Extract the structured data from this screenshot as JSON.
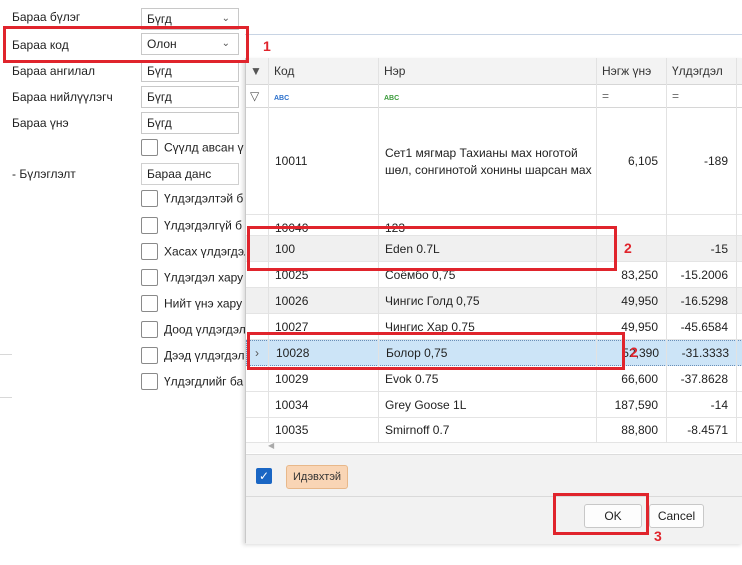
{
  "filters": {
    "category_label": "Бараа бүлэг",
    "category_value": "Бүгд",
    "code_label": "Бараа код",
    "code_value": "Олон",
    "class_label": "Бараа ангилал",
    "class_value": "Бүгд",
    "supplier_label": "Бараа нийлүүлэгч",
    "supplier_value": "Бүгд",
    "price_label": "Бараа үнэ",
    "price_value": "Бүгд",
    "last_taken_label": "Сүүлд авсан ү",
    "grouping_label": "- Бүлэглэлт",
    "grouping_value": "Бараа данс",
    "checkboxes": [
      "Үлдэгдэлтэй б",
      "Үлдэгдэлгүй б",
      "Хасах үлдэгдэл",
      "Үлдэгдэл хару",
      "Нийт үнэ хару",
      "Доод үлдэгдэл",
      "Дээд үлдэгдэл",
      "Үлдэгдлийг ба"
    ]
  },
  "grid": {
    "columns": [
      "Код",
      "Нэр",
      "Нэгж үнэ",
      "Үлдэгдэл"
    ],
    "rows": [
      {
        "code": "10011",
        "name1": "Сет1 мягмар Тахианы мах ноготой",
        "name2": "шөл, сонгинотой хонины шарсан мах",
        "price": "6,105",
        "stock": "-189"
      },
      {
        "code": "10040",
        "name": "123",
        "price": "",
        "stock": ""
      },
      {
        "code": "100",
        "name": "Eden 0.7L",
        "price": "",
        "stock": "-15"
      },
      {
        "code": "10025",
        "name": "Соёмбо 0,75",
        "price": "83,250",
        "stock": "-15.2006"
      },
      {
        "code": "10026",
        "name": "Чингис Голд 0,75",
        "price": "49,950",
        "stock": "-16.5298"
      },
      {
        "code": "10027",
        "name": "Чингис Хар 0.75",
        "price": "49,950",
        "stock": "-45.6584"
      },
      {
        "code": "10028",
        "name": "Болор 0,75",
        "price": "52,390",
        "stock": "-31.3333"
      },
      {
        "code": "10029",
        "name": "Evok 0.75",
        "price": "66,600",
        "stock": "-37.8628"
      },
      {
        "code": "10034",
        "name": "Grey Goose 1L",
        "price": "187,590",
        "stock": "-14"
      },
      {
        "code": "10035",
        "name": "Smirnoff 0.7",
        "price": "88,800",
        "stock": "-8.4571"
      }
    ]
  },
  "footer": {
    "active_badge": "Идэвхтэй",
    "ok_label": "OK",
    "cancel_label": "Cancel"
  },
  "annotations": {
    "n1": "1",
    "n2a": "2",
    "n2b": "2",
    "n3": "3"
  },
  "colors": {
    "annotation": "#e0242c",
    "selection": "#cce4f7",
    "checkbox_checked": "#1a66c4"
  }
}
